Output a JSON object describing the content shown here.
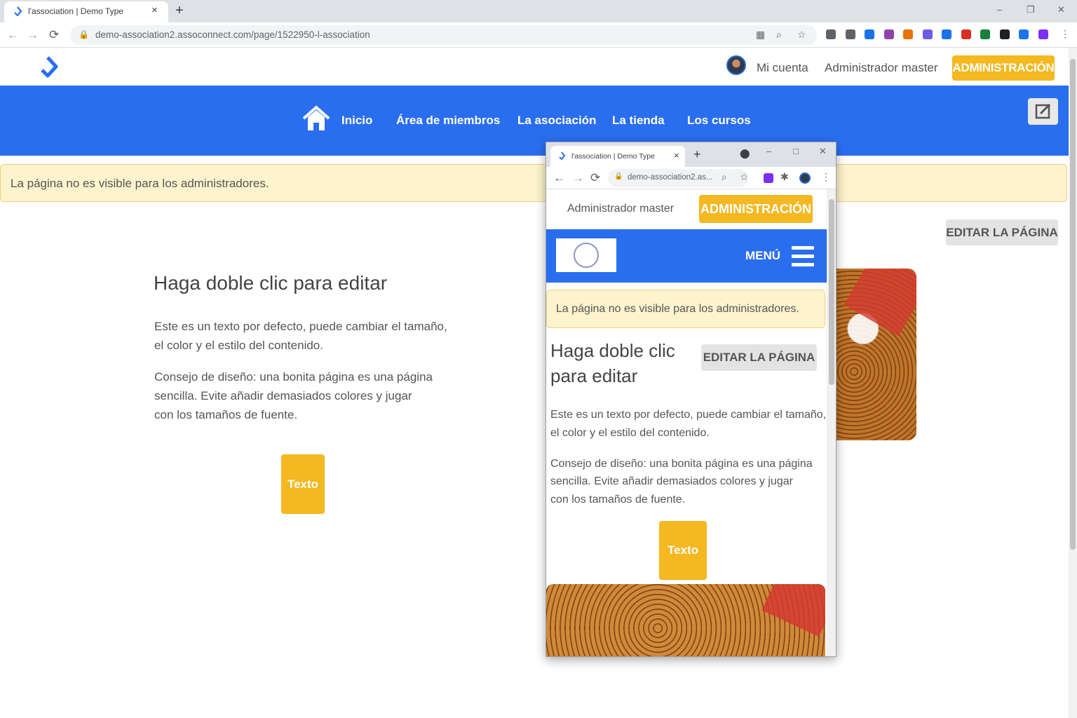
{
  "browser": {
    "tab_title": "l'association | Demo Type",
    "tab_close": "×",
    "new_tab": "+",
    "window_controls": [
      "–",
      "❐",
      "✕"
    ],
    "url": "demo-association2.assoconnect.com/page/1522950-l-association",
    "back": "←",
    "forward": "→",
    "reload": "⟳",
    "lock": "🔒",
    "zoom_icon": "⌕",
    "star_icon": "☆",
    "menu_icon": "⋮",
    "extension_colors": [
      "#5f6368",
      "#5f6368",
      "#1a73e8",
      "#8e44ad",
      "#e8710a",
      "#6c5ce7",
      "#1a73e8",
      "#d93025",
      "#188038",
      "#202124",
      "#1a73e8",
      "#7b2ff7"
    ]
  },
  "header": {
    "my_account": "Mi cuenta",
    "admin_master": "Administrador master",
    "admin_button": "ADMINISTRACIÓN",
    "brand_color": "#2a6ef0",
    "accent_color": "#f4b820"
  },
  "nav": {
    "items": [
      "Inicio",
      "Área de miembros",
      "La asociación",
      "La tienda",
      "Los cursos"
    ]
  },
  "notice": "La página no es visible para los administradores.",
  "edit_page_button": "EDITAR LA PÁGINA",
  "content": {
    "title": "Haga doble clic para editar",
    "para1_line1": "Este es un texto por defecto, puede cambiar el tamaño,",
    "para1_line2": "el color y el estilo del contenido.",
    "para2_line1": "Consejo de diseño: una bonita página es una página",
    "para2_line2": "sencilla. Evite añadir demasiados colores y jugar",
    "para2_line3": "con los tamaños de fuente.",
    "texto_button": "Texto"
  },
  "popup": {
    "tab_title": "l'association | Demo Type",
    "url": "demo-association2.as...",
    "admin_master": "Administrador master",
    "admin_button": "ADMINISTRACIÓN",
    "menu_label": "MENÚ",
    "notice": "La página no es visible para los administradores.",
    "title": "Haga doble clic para editar",
    "edit_button": "EDITAR LA PÁGINA",
    "para1_line1": "Este es un texto por defecto, puede cambiar el tamaño,",
    "para1_line2": "el color y el estilo del contenido.",
    "para2_line1": "Consejo de diseño: una bonita página es una página",
    "para2_line2": "sencilla. Evite añadir demasiados colores y jugar",
    "para2_line3": "con los tamaños de fuente.",
    "texto_button": "Texto"
  }
}
